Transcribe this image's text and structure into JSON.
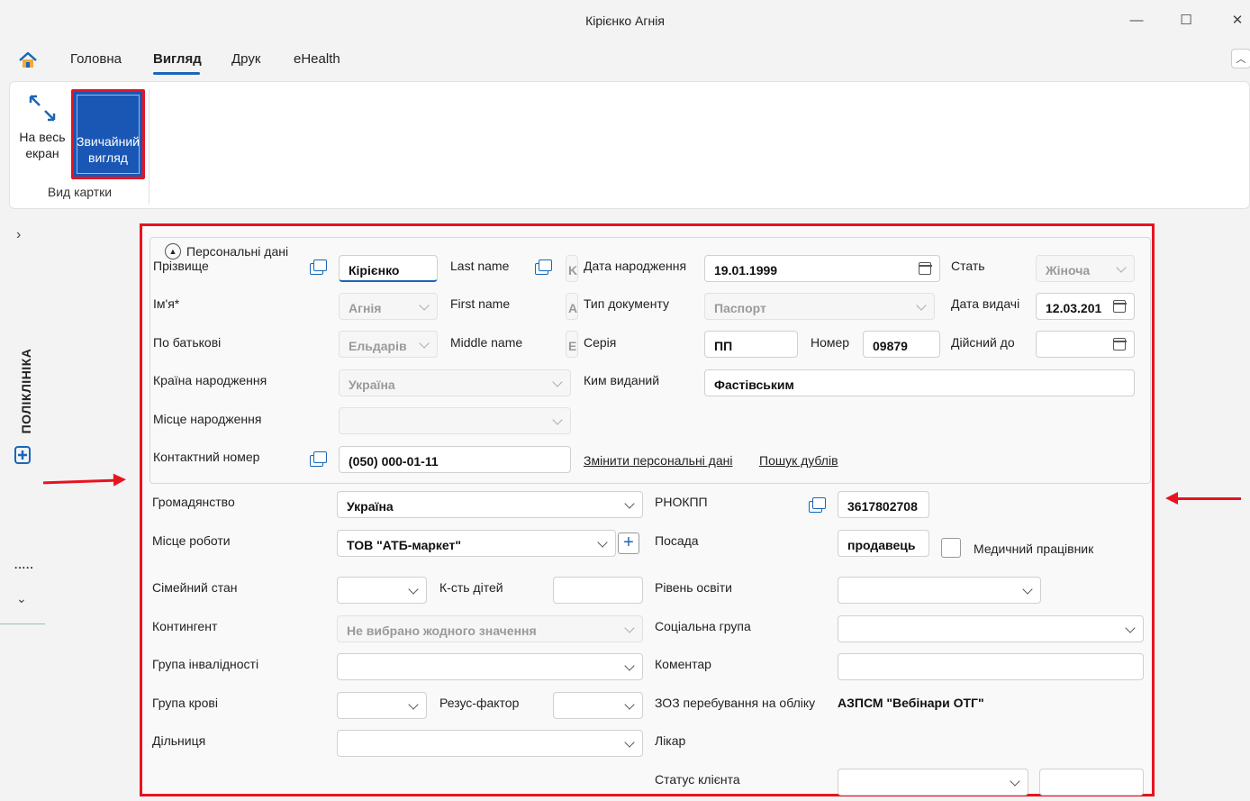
{
  "window": {
    "title": "Кірієнко Агнія",
    "minimize": "—",
    "maximize": "☐",
    "close": "✕"
  },
  "tabs": [
    "Головна",
    "Вигляд",
    "Друк",
    "eHealth"
  ],
  "ribbon": {
    "fullscreen_label_1": "На весь",
    "fullscreen_label_2": "екран",
    "normal_label_1": "Звичайний",
    "normal_label_2": "вигляд",
    "group_label": "Вид картки"
  },
  "sidebar": {
    "label": "ПОЛІКЛІНІКА",
    "dots": "....."
  },
  "personal": {
    "title": "Персональні дані",
    "surname_label": "Прізвище",
    "surname": "Кірієнко",
    "lastname_label": "Last name",
    "lastname": "K",
    "birthdate_label": "Дата народження",
    "birthdate": "19.01.1999",
    "sex_label": "Стать",
    "sex": "Жіноча",
    "name_label": "Ім'я*",
    "name": "Агнія",
    "firstname_label": "First name",
    "firstname": "A",
    "doctype_label": "Тип документу",
    "doctype": "Паспорт",
    "issue_date_label": "Дата видачі",
    "issue_date": "12.03.201",
    "patronymic_label": "По батькові",
    "patronymic": "Ельдарів",
    "middlename_label": "Middle name",
    "middlename": "E",
    "series_label": "Серія",
    "series": "ПП",
    "number_label": "Номер",
    "number": "09879",
    "valid_until_label": "Дійсний до",
    "birth_country_label": "Країна народження",
    "birth_country": "Україна",
    "issued_by_label": "Ким виданий",
    "issued_by": "Фастівським",
    "birth_place_label": "Місце народження",
    "phone_label": "Контактний номер",
    "phone": "(050) 000-01-11",
    "change_link": "Змінити персональні дані",
    "duplicates_link": "Пошук дублів"
  },
  "extra": {
    "citizenship_label": "Громадянство",
    "citizenship": "Україна",
    "rnokpp_label": "РНОКПП",
    "rnokpp": "3617802708",
    "workplace_label": "Місце роботи",
    "workplace": "ТОВ \"АТБ-маркет\"",
    "position_label": "Посада",
    "position": "продавець",
    "medical_worker_label": "Медичний працівник",
    "marital_label": "Сімейний стан",
    "children_label": "К-сть дітей",
    "education_label": "Рівень освіти",
    "contingent_label": "Контингент",
    "contingent": "Не вибрано жодного значення",
    "social_label": "Соціальна група",
    "disability_label": "Група інвалідності",
    "comment_label": "Коментар",
    "blood_label": "Група крові",
    "rh_label": "Резус-фактор",
    "zoz_label": "ЗОЗ перебування на обліку",
    "zoz": "АЗПСМ \"Вебінари ОТГ\"",
    "district_label": "Дільниця",
    "doctor_label": "Лікар",
    "status_label": "Статус клієнта"
  },
  "colors": {
    "accent": "#1a57b5",
    "highlight": "#e8131f"
  }
}
